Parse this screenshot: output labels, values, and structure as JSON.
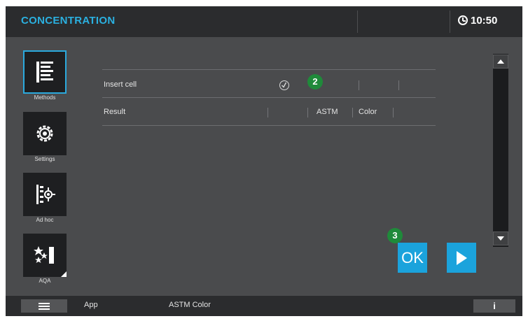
{
  "header": {
    "title": "CONCENTRATION",
    "time": "10:50",
    "clock_icon": "clock-icon"
  },
  "sidebar": {
    "items": [
      {
        "label": "Methods",
        "icon": "methods-list-icon",
        "active": true
      },
      {
        "label": "Settings",
        "icon": "gear-icon",
        "active": false
      },
      {
        "label": "Ad hoc",
        "icon": "ad-hoc-icon",
        "active": false
      },
      {
        "label": "AQA",
        "icon": "aqa-stars-icon",
        "active": false
      }
    ]
  },
  "table": {
    "rows": [
      {
        "label": "Insert cell",
        "status_icon": "check-circle-icon"
      },
      {
        "label": "Result",
        "cells": [
          "ASTM",
          "Color"
        ]
      }
    ]
  },
  "badges": {
    "step2": "2",
    "step3": "3"
  },
  "actions": {
    "ok_label": "OK",
    "play_icon": "play-icon"
  },
  "footer": {
    "menu_icon": "hamburger-icon",
    "app_label": "App",
    "method_label": "ASTM Color",
    "info_label": "i"
  },
  "colors": {
    "accent": "#1ba3dc",
    "title": "#2bb0e0",
    "badge": "#1f8a3a",
    "background": "#4a4b4d",
    "bar": "#2b2c2e"
  }
}
